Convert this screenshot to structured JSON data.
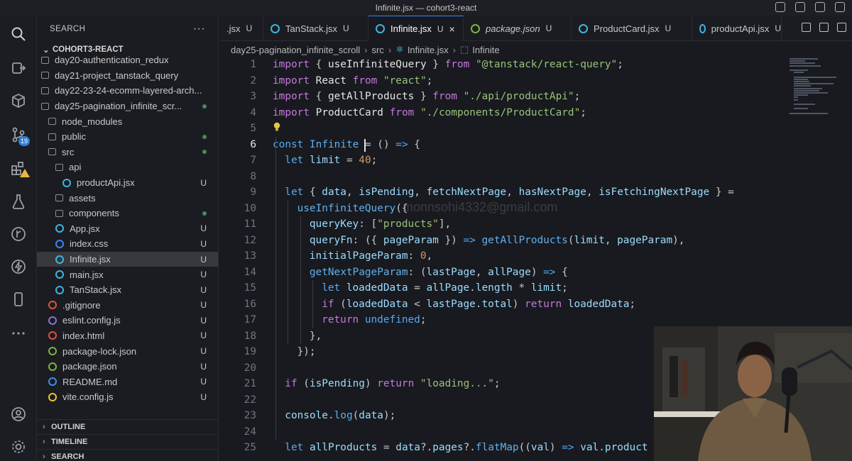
{
  "window": {
    "title": "Infinite.jsx — cohort3-react"
  },
  "activity_bar": {
    "items": [
      {
        "name": "search-icon"
      },
      {
        "name": "remote-explorer-icon"
      },
      {
        "name": "extensions-box-icon"
      },
      {
        "name": "source-control-icon",
        "badge": "19"
      },
      {
        "name": "extensions-icon",
        "warning": true
      },
      {
        "name": "testing-icon"
      },
      {
        "name": "git-graph-icon"
      },
      {
        "name": "lightning-icon"
      },
      {
        "name": "mobile-icon"
      },
      {
        "name": "more-icon"
      }
    ],
    "bottom": [
      {
        "name": "account-icon"
      },
      {
        "name": "settings-gear-icon"
      }
    ]
  },
  "sidebar": {
    "header": "SEARCH",
    "project": "COHORT3-REACT",
    "tree": [
      {
        "label": "day20-authentication_redux",
        "kind": "folder",
        "depth": 1,
        "status": ""
      },
      {
        "label": "day21-project_tanstack_query",
        "kind": "folder",
        "depth": 1,
        "status": ""
      },
      {
        "label": "day22-23-24-ecomm-layered-arch...",
        "kind": "folder",
        "depth": 1,
        "status": ""
      },
      {
        "label": "day25-pagination_infinite_scr...",
        "kind": "folder-open",
        "depth": 1,
        "status": "dot-green"
      },
      {
        "label": "node_modules",
        "kind": "folder",
        "depth": 2,
        "status": ""
      },
      {
        "label": "public",
        "kind": "folder",
        "depth": 2,
        "status": "dot-green"
      },
      {
        "label": "src",
        "kind": "folder-open",
        "depth": 2,
        "status": "dot-green"
      },
      {
        "label": "api",
        "kind": "folder-open",
        "depth": 3,
        "status": ""
      },
      {
        "label": "productApi.jsx",
        "kind": "react",
        "depth": 4,
        "status": "U"
      },
      {
        "label": "assets",
        "kind": "folder",
        "depth": 3,
        "status": ""
      },
      {
        "label": "components",
        "kind": "folder",
        "depth": 3,
        "status": "dot-green"
      },
      {
        "label": "App.jsx",
        "kind": "react",
        "depth": 3,
        "status": "U"
      },
      {
        "label": "index.css",
        "kind": "css",
        "depth": 3,
        "status": "U"
      },
      {
        "label": "Infinite.jsx",
        "kind": "react",
        "depth": 3,
        "status": "U",
        "active": true
      },
      {
        "label": "main.jsx",
        "kind": "react",
        "depth": 3,
        "status": "U"
      },
      {
        "label": "TanStack.jsx",
        "kind": "react",
        "depth": 3,
        "status": "U"
      },
      {
        "label": ".gitignore",
        "kind": "git",
        "depth": 2,
        "status": "U"
      },
      {
        "label": "eslint.config.js",
        "kind": "eslint",
        "depth": 2,
        "status": "U"
      },
      {
        "label": "index.html",
        "kind": "html",
        "depth": 2,
        "status": "U"
      },
      {
        "label": "package-lock.json",
        "kind": "node",
        "depth": 2,
        "status": "U"
      },
      {
        "label": "package.json",
        "kind": "node",
        "depth": 2,
        "status": "U"
      },
      {
        "label": "README.md",
        "kind": "info",
        "depth": 2,
        "status": "U"
      },
      {
        "label": "vite.config.js",
        "kind": "vite",
        "depth": 2,
        "status": "U"
      }
    ],
    "panels": [
      "OUTLINE",
      "TIMELINE",
      "SEARCH"
    ]
  },
  "tabs": [
    {
      "label": ".jsx",
      "status": "U",
      "icon": "react",
      "active": false
    },
    {
      "label": "TanStack.jsx",
      "status": "U",
      "icon": "react",
      "active": false
    },
    {
      "label": "Infinite.jsx",
      "status": "U",
      "icon": "react",
      "active": true
    },
    {
      "label": "package.json",
      "status": "U",
      "icon": "node",
      "active": false,
      "italic": true
    },
    {
      "label": "ProductCard.jsx",
      "status": "U",
      "icon": "react",
      "active": false
    },
    {
      "label": "productApi.jsx",
      "status": "U",
      "icon": "react",
      "active": false
    }
  ],
  "breadcrumb": [
    "day25-pagination_infinite_scroll",
    "src",
    "Infinite.jsx",
    "Infinite"
  ],
  "editor": {
    "current_line": 6,
    "watermark": "monnsohi4332@gmail.com",
    "lines": [
      {
        "n": 1,
        "indent": 0,
        "tokens": [
          [
            "kw",
            "import"
          ],
          [
            "op",
            " { "
          ],
          [
            "va",
            "useInfiniteQuery"
          ],
          [
            "op",
            " } "
          ],
          [
            "kw",
            "from"
          ],
          [
            "op",
            " "
          ],
          [
            "st",
            "\"@tanstack/react-query\""
          ],
          [
            "op",
            ";"
          ]
        ]
      },
      {
        "n": 2,
        "indent": 0,
        "tokens": [
          [
            "kw",
            "import"
          ],
          [
            "op",
            " "
          ],
          [
            "va",
            "React"
          ],
          [
            "op",
            " "
          ],
          [
            "kw",
            "from"
          ],
          [
            "op",
            " "
          ],
          [
            "st",
            "\"react\""
          ],
          [
            "op",
            ";"
          ]
        ]
      },
      {
        "n": 3,
        "indent": 0,
        "tokens": [
          [
            "kw",
            "import"
          ],
          [
            "op",
            " { "
          ],
          [
            "va",
            "getAllProducts"
          ],
          [
            "op",
            " } "
          ],
          [
            "kw",
            "from"
          ],
          [
            "op",
            " "
          ],
          [
            "st",
            "\"./api/productApi\""
          ],
          [
            "op",
            ";"
          ]
        ]
      },
      {
        "n": 4,
        "indent": 0,
        "tokens": [
          [
            "kw",
            "import"
          ],
          [
            "op",
            " "
          ],
          [
            "va",
            "ProductCard"
          ],
          [
            "op",
            " "
          ],
          [
            "kw",
            "from"
          ],
          [
            "op",
            " "
          ],
          [
            "st",
            "\"./components/ProductCard\""
          ],
          [
            "op",
            ";"
          ]
        ]
      },
      {
        "n": 5,
        "indent": 0,
        "tokens": []
      },
      {
        "n": 6,
        "indent": 0,
        "tokens": [
          [
            "kb",
            "const"
          ],
          [
            "op",
            " "
          ],
          [
            "fn",
            "Infinite"
          ],
          [
            "op",
            " = () "
          ],
          [
            "kb",
            "=>"
          ],
          [
            "op",
            " {"
          ]
        ]
      },
      {
        "n": 7,
        "indent": 1,
        "tokens": [
          [
            "kb",
            "let"
          ],
          [
            "op",
            " "
          ],
          [
            "pr",
            "limit"
          ],
          [
            "op",
            " = "
          ],
          [
            "nm",
            "40"
          ],
          [
            "op",
            ";"
          ]
        ]
      },
      {
        "n": 8,
        "indent": 0,
        "tokens": []
      },
      {
        "n": 9,
        "indent": 1,
        "tokens": [
          [
            "kb",
            "let"
          ],
          [
            "op",
            " { "
          ],
          [
            "pr",
            "data"
          ],
          [
            "op",
            ", "
          ],
          [
            "pr",
            "isPending"
          ],
          [
            "op",
            ", "
          ],
          [
            "pr",
            "fetchNextPage"
          ],
          [
            "op",
            ", "
          ],
          [
            "pr",
            "hasNextPage"
          ],
          [
            "op",
            ", "
          ],
          [
            "pr",
            "isFetchingNextPage"
          ],
          [
            "op",
            " } ="
          ]
        ]
      },
      {
        "n": 10,
        "indent": 2,
        "tokens": [
          [
            "fn",
            "useInfiniteQuery"
          ],
          [
            "op",
            "({"
          ]
        ]
      },
      {
        "n": 11,
        "indent": 3,
        "tokens": [
          [
            "pr",
            "queryKey"
          ],
          [
            "op",
            ": ["
          ],
          [
            "st",
            "\"products\""
          ],
          [
            "op",
            "],"
          ]
        ]
      },
      {
        "n": 12,
        "indent": 3,
        "tokens": [
          [
            "pr",
            "queryFn"
          ],
          [
            "op",
            ": ({ "
          ],
          [
            "pr",
            "pageParam"
          ],
          [
            "op",
            " }) "
          ],
          [
            "kb",
            "=>"
          ],
          [
            "op",
            " "
          ],
          [
            "fn",
            "getAllProducts"
          ],
          [
            "op",
            "("
          ],
          [
            "pr",
            "limit"
          ],
          [
            "op",
            ", "
          ],
          [
            "pr",
            "pageParam"
          ],
          [
            "op",
            "),"
          ]
        ]
      },
      {
        "n": 13,
        "indent": 3,
        "tokens": [
          [
            "pr",
            "initialPageParam"
          ],
          [
            "op",
            ": "
          ],
          [
            "nm",
            "0"
          ],
          [
            "op",
            ","
          ]
        ]
      },
      {
        "n": 14,
        "indent": 3,
        "tokens": [
          [
            "fn",
            "getNextPageParam"
          ],
          [
            "op",
            ": ("
          ],
          [
            "pr",
            "lastPage"
          ],
          [
            "op",
            ", "
          ],
          [
            "pr",
            "allPage"
          ],
          [
            "op",
            ") "
          ],
          [
            "kb",
            "=>"
          ],
          [
            "op",
            " {"
          ]
        ]
      },
      {
        "n": 15,
        "indent": 4,
        "tokens": [
          [
            "kb",
            "let"
          ],
          [
            "op",
            " "
          ],
          [
            "pr",
            "loadedData"
          ],
          [
            "op",
            " = "
          ],
          [
            "pr",
            "allPage"
          ],
          [
            "op",
            "."
          ],
          [
            "pr",
            "length"
          ],
          [
            "op",
            " * "
          ],
          [
            "pr",
            "limit"
          ],
          [
            "op",
            ";"
          ]
        ]
      },
      {
        "n": 16,
        "indent": 4,
        "tokens": [
          [
            "kw",
            "if"
          ],
          [
            "op",
            " ("
          ],
          [
            "pr",
            "loadedData"
          ],
          [
            "op",
            " < "
          ],
          [
            "pr",
            "lastPage"
          ],
          [
            "op",
            "."
          ],
          [
            "pr",
            "total"
          ],
          [
            "op",
            ") "
          ],
          [
            "kw",
            "return"
          ],
          [
            "op",
            " "
          ],
          [
            "pr",
            "loadedData"
          ],
          [
            "op",
            ";"
          ]
        ]
      },
      {
        "n": 17,
        "indent": 4,
        "tokens": [
          [
            "kw",
            "return"
          ],
          [
            "op",
            " "
          ],
          [
            "kb",
            "undefined"
          ],
          [
            "op",
            ";"
          ]
        ]
      },
      {
        "n": 18,
        "indent": 3,
        "tokens": [
          [
            "op",
            "},"
          ]
        ]
      },
      {
        "n": 19,
        "indent": 2,
        "tokens": [
          [
            "op",
            "});"
          ]
        ]
      },
      {
        "n": 20,
        "indent": 0,
        "tokens": []
      },
      {
        "n": 21,
        "indent": 1,
        "tokens": [
          [
            "kw",
            "if"
          ],
          [
            "op",
            " ("
          ],
          [
            "pr",
            "isPending"
          ],
          [
            "op",
            ") "
          ],
          [
            "kw",
            "return"
          ],
          [
            "op",
            " "
          ],
          [
            "st",
            "\"loading...\""
          ],
          [
            "op",
            ";"
          ]
        ]
      },
      {
        "n": 22,
        "indent": 0,
        "tokens": []
      },
      {
        "n": 23,
        "indent": 1,
        "tokens": [
          [
            "pr",
            "console"
          ],
          [
            "op",
            "."
          ],
          [
            "fn",
            "log"
          ],
          [
            "op",
            "("
          ],
          [
            "pr",
            "data"
          ],
          [
            "op",
            ");"
          ]
        ]
      },
      {
        "n": 24,
        "indent": 0,
        "tokens": []
      },
      {
        "n": 25,
        "indent": 1,
        "tokens": [
          [
            "kb",
            "let"
          ],
          [
            "op",
            " "
          ],
          [
            "pr",
            "allProducts"
          ],
          [
            "op",
            " = "
          ],
          [
            "pr",
            "data"
          ],
          [
            "op",
            "?."
          ],
          [
            "pr",
            "pages"
          ],
          [
            "op",
            "?."
          ],
          [
            "fn",
            "flatMap"
          ],
          [
            "op",
            "(("
          ],
          [
            "pr",
            "val"
          ],
          [
            "op",
            ") "
          ],
          [
            "kb",
            "=>"
          ],
          [
            "op",
            " "
          ],
          [
            "pr",
            "val"
          ],
          [
            "op",
            "."
          ],
          [
            "pr",
            "product"
          ]
        ]
      }
    ]
  }
}
